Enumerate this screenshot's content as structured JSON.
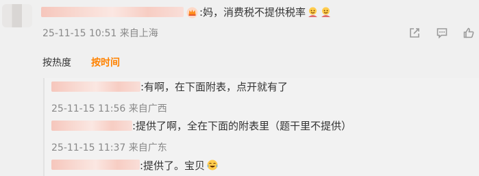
{
  "main_comment": {
    "text": ":妈，消费税不提供税率",
    "timestamp": "25-11-15 10:51",
    "location": "来自上海"
  },
  "sort": {
    "hot_label": "按热度",
    "time_label": "按时间"
  },
  "replies": [
    {
      "text": ":有啊，在下面附表，点开就有了",
      "timestamp": "25-11-15 11:56",
      "location": "来自广西"
    },
    {
      "text": ":提供了啊，全在下面的附表里（题干里不提供）",
      "timestamp": "25-11-15 11:37",
      "location": "来自广东"
    },
    {
      "text": ":提供了。宝贝"
    }
  ],
  "icons": [
    "avatar",
    "crown-icon",
    "emoji-icon",
    "share-icon",
    "comment-icon",
    "like-icon",
    "laugh-cry-emoji-icon"
  ],
  "colors": {
    "accent": "#ff8200",
    "meta_gray": "#888888",
    "background": "#f0f0f0"
  }
}
